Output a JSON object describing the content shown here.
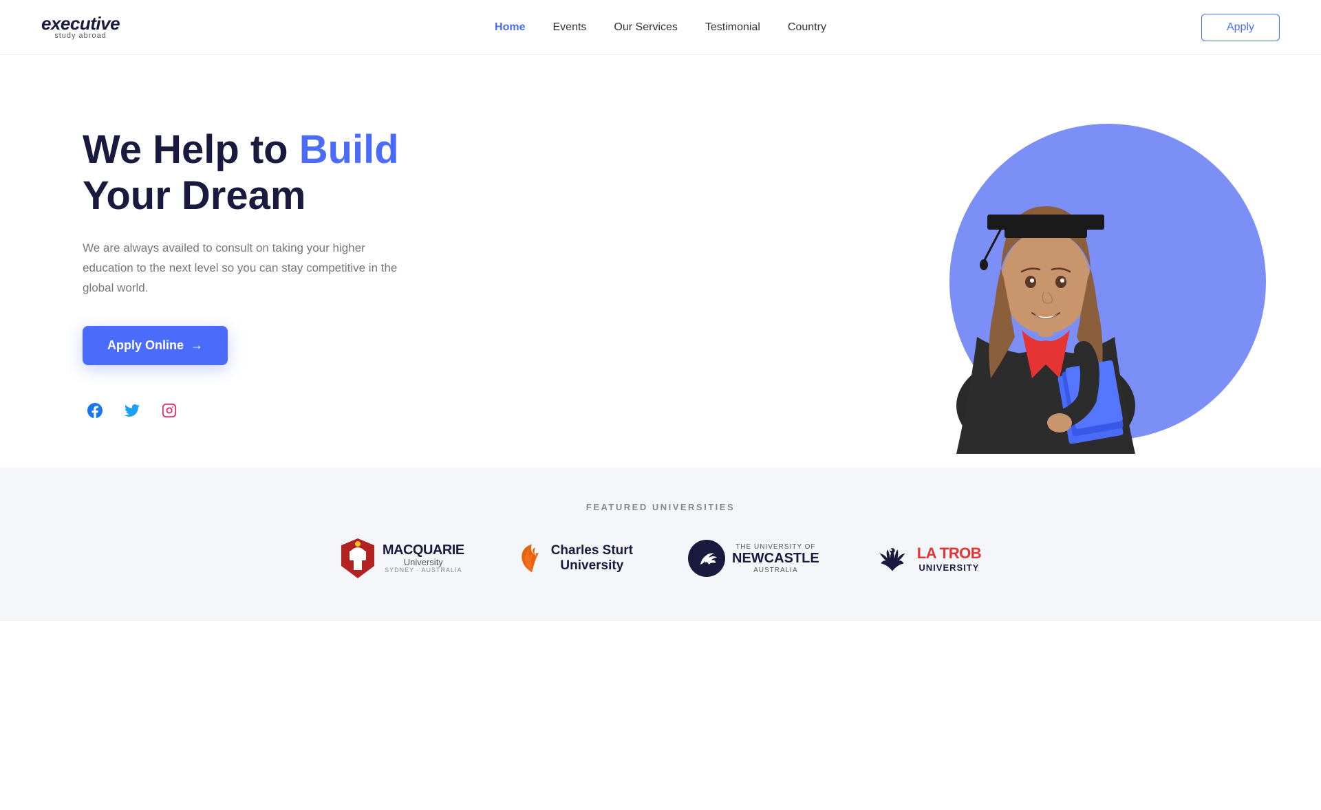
{
  "brand": {
    "name": "executive",
    "tagline": "study abroad"
  },
  "nav": {
    "links": [
      {
        "label": "Home",
        "active": true
      },
      {
        "label": "Events",
        "active": false
      },
      {
        "label": "Our Services",
        "active": false
      },
      {
        "label": "Testimonial",
        "active": false
      },
      {
        "label": "Country",
        "active": false
      }
    ],
    "apply_label": "Apply"
  },
  "hero": {
    "title_prefix": "We Help to ",
    "title_highlight": "Build",
    "title_suffix": "Your Dream",
    "description": "We are always availed to consult on taking your higher education to the next level so you can stay competitive in the global world.",
    "apply_online_label": "Apply Online",
    "apply_arrow": "→"
  },
  "social": {
    "facebook_icon": "f",
    "twitter_icon": "t",
    "instagram_icon": "i"
  },
  "featured": {
    "label": "FEATURED UNIVERSITIES",
    "universities": [
      {
        "name": "Macquarie University",
        "location": "SYDNEY · AUSTRALIA"
      },
      {
        "name": "Charles Sturt University"
      },
      {
        "name": "The University of Newcastle Australia"
      },
      {
        "name": "La Trobe University"
      }
    ]
  }
}
